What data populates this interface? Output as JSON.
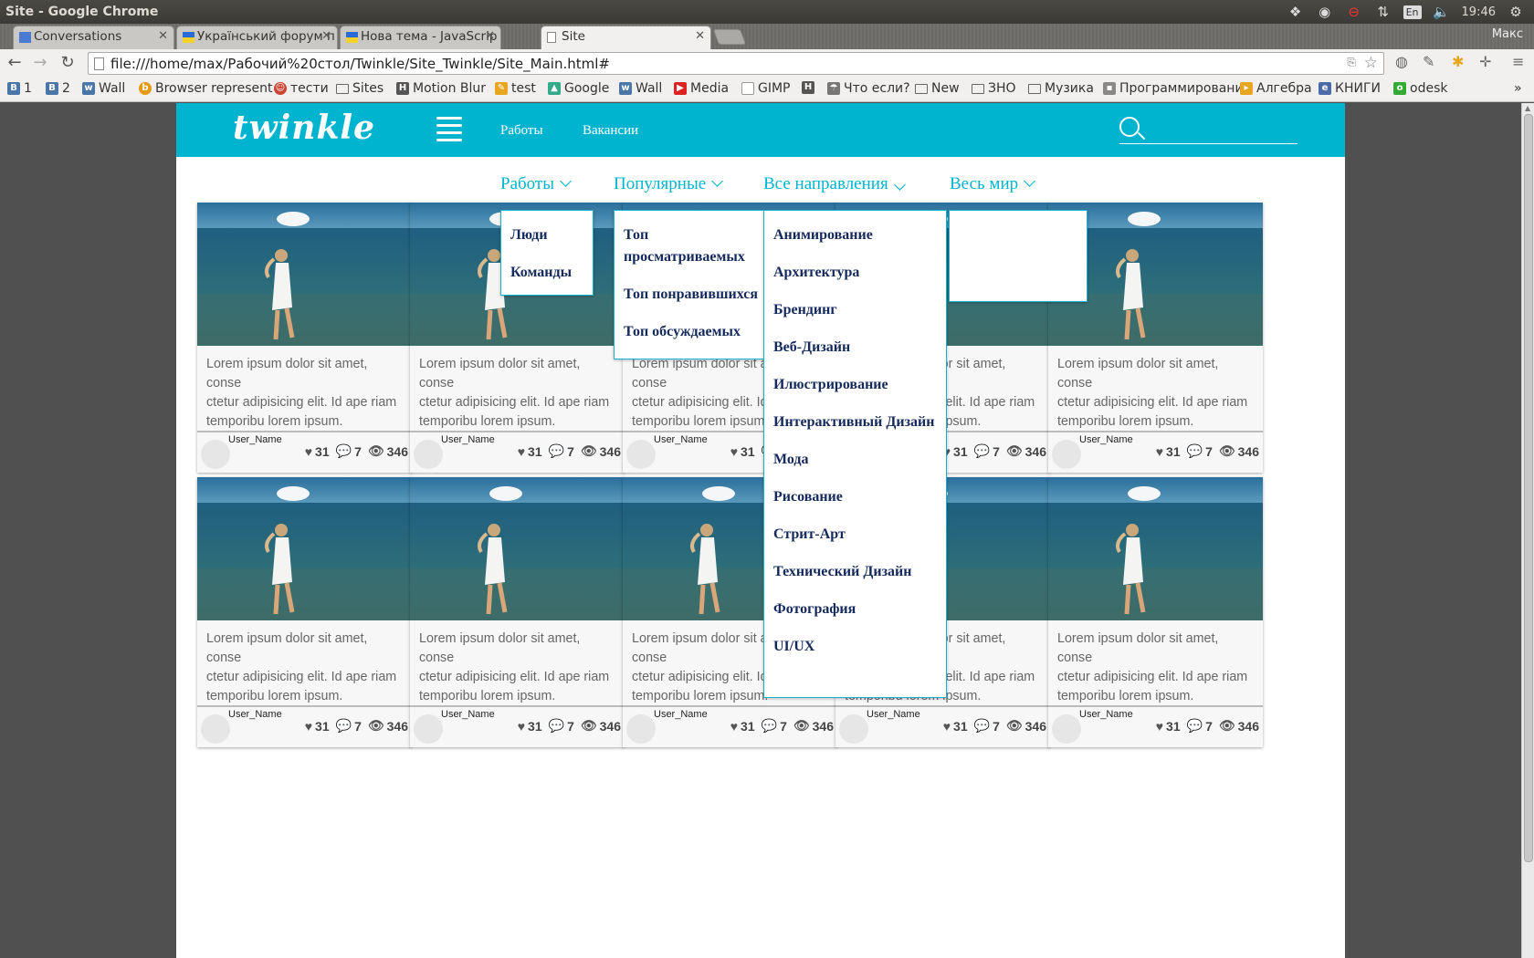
{
  "window": {
    "title": "Site - Google Chrome",
    "user": "Макс",
    "time": "19:46",
    "lang": "En"
  },
  "tabs": [
    {
      "label": "Conversations",
      "icon": "chat-icon"
    },
    {
      "label": "Український форум п",
      "icon": "flag-icon"
    },
    {
      "label": "Нова тема - JavaScrip",
      "icon": "flag-icon"
    },
    {
      "label": "Site",
      "icon": "page-icon"
    }
  ],
  "address": {
    "url": "file:///home/max/Рабочий%20стол/Twinkle/Site_Twinkle/Site_Main.html#"
  },
  "bookmarks": [
    "1",
    "2",
    "Wall",
    "Browser represent",
    "тести",
    "Sites",
    "Motion Blur",
    "test",
    "Google",
    "Wall",
    "Media",
    "GIMP",
    "",
    "Что если?",
    "New",
    "ЗНО",
    "Музика",
    "Программировани",
    "Алгебра",
    "КНИГИ",
    "odesk"
  ],
  "site": {
    "logo": "twinkle",
    "nav": [
      "Работы",
      "Вакансии"
    ],
    "search_value": "",
    "filters": [
      "Работы",
      "Популярные",
      "Все направления",
      "Весь мир"
    ],
    "menu_works": [
      "Люди",
      "Команды"
    ],
    "menu_popular": [
      "Топ просматриваемых",
      "Топ понравившихся",
      "Топ обсуждаемых"
    ],
    "menu_directions": [
      "Анимирование",
      "Архитектура",
      "Брендинг",
      "Веб-Дизайн",
      "Илюстрирование",
      "Интерактивный Дизайн",
      "Мода",
      "Рисование",
      "Стрит-Арт",
      "Технический Дизайн",
      "Фотография",
      "UI/UX"
    ],
    "card": {
      "text": "Lorem ipsum dolor sit amet, consectetur adipisicing elit. Id ape riam temporibu lorem ipsum.",
      "line1": "Lorem ipsum dolor sit amet, conse",
      "line2": "ctetur adipisicing elit. Id ape riam",
      "line3": "temporibu lorem ipsum.",
      "user": "User_Name",
      "likes": "31",
      "comments": "7",
      "views": "346"
    }
  },
  "colors": {
    "accent": "#00b4d0",
    "menu_text": "#152a5c"
  }
}
